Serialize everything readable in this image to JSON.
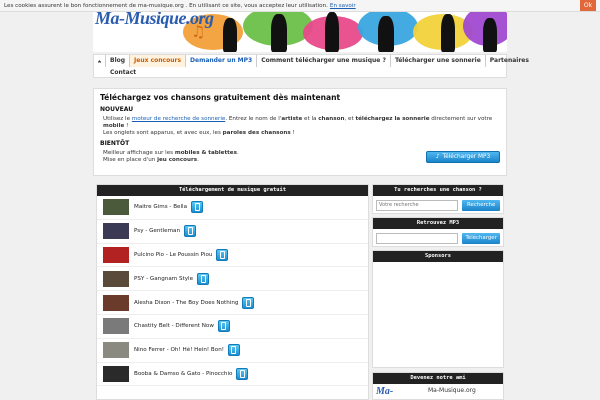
{
  "cookie": {
    "text": "Les cookies assurent le bon fonctionnement de ma-musique.org . En utilisant ce site, vous acceptez leur utilisation.",
    "link": "En savoir",
    "ok_label": "Ok"
  },
  "header": {
    "logo_text": "Ma-Musique.org"
  },
  "nav": {
    "row1": [
      "Blog",
      "Jeux concours",
      "Demander un MP3",
      "Comment télécharger une musique ?",
      "Télécharger une sonnerie",
      "Partenaires"
    ],
    "row2": [
      "Contact"
    ]
  },
  "intro": {
    "title": "Téléchargez vos chansons gratuitement dès maintenant",
    "section1_title": "NOUVEAU",
    "s1_line1_a": "Utilisez le",
    "s1_link": "moteur de recherche de sonnerie",
    "s1_line1_b": ". Entrez le nom de l'",
    "s1_bold1": "artiste",
    "s1_line1_c": " et la",
    "s1_bold2": "chanson",
    "s1_line1_d": ", et",
    "s1_bold3": "téléchargez la sonnerie",
    "s1_line1_e": " directement sur votre",
    "s1_bold4": "mobile",
    "s1_line1_f": " !",
    "s1_line2_a": "Les onglets sont apparus, et avec eux, les",
    "s1_bold5": "paroles des chansons",
    "s1_line2_b": " !",
    "section2_title": "BIENTÔT",
    "s2_line1_a": "Meilleur affichage sur les",
    "s2_bold1": "mobiles & tablettes",
    "s2_line1_b": ".",
    "s2_line2_a": "Mise en place d'un",
    "s2_bold2": "jeu concours",
    "s2_line2_b": ".",
    "button_label": "Télécharger MP3"
  },
  "downloads": {
    "heading": "Téléchargement de musique gratuit",
    "songs": [
      {
        "title": "Maitre Gims - Bella",
        "color": "#4a5a3a"
      },
      {
        "title": "Psy - Gentleman",
        "color": "#3a3a55"
      },
      {
        "title": "Pulcino Pio - Le Poussin Piou",
        "color": "#b22222"
      },
      {
        "title": "PSY - Gangnam Style",
        "color": "#5a4a3a"
      },
      {
        "title": "Alesha Dixon - The Boy Does Nothing",
        "color": "#6a3a2a"
      },
      {
        "title": "Chastity Belt - Different Now",
        "color": "#7a7a7a"
      },
      {
        "title": "Nino Ferrer - Oh! Hé! Hein! Bon!",
        "color": "#8a8a80"
      },
      {
        "title": "Booba & Damso & Gato - Pinocchio",
        "color": "#2a2a2a"
      }
    ]
  },
  "sidebar": {
    "search_heading": "Tu recherches une chanson ?",
    "search_placeholder": "Votre recherche",
    "search_button": "Recherche",
    "mp3_heading": "Retrouvez MP3",
    "mp3_button": "Télécharger",
    "sponsors_heading": "Sponsors",
    "member_heading": "Devenez notre ami",
    "member_logo": "Ma-",
    "member_text": "Ma-Musique.org"
  }
}
